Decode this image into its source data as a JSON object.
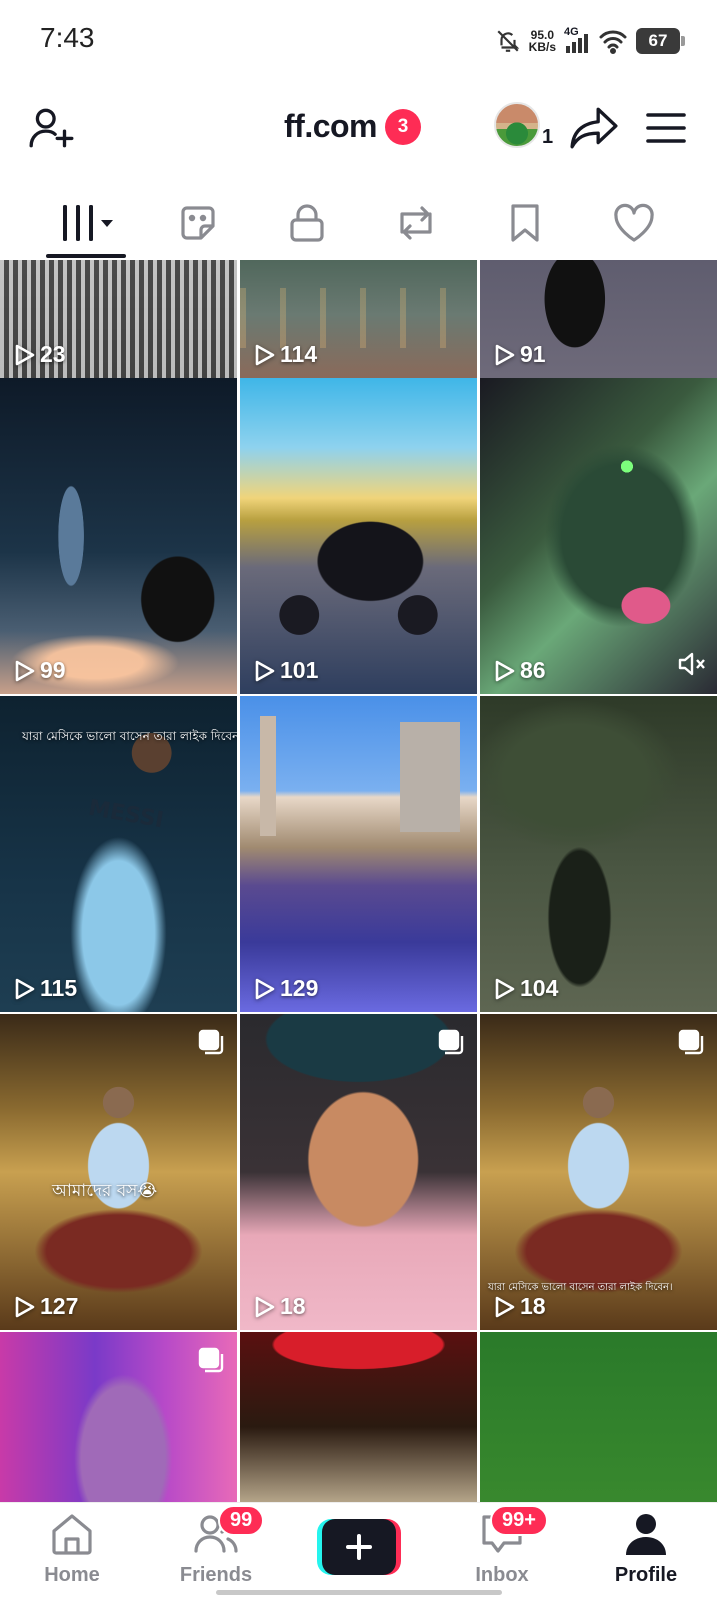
{
  "status_bar": {
    "time": "7:43",
    "net_speed_value": "95.0",
    "net_speed_unit": "KB/s",
    "network_type": "4G",
    "battery": "67"
  },
  "header": {
    "title": "ff.com",
    "title_badge": "3",
    "avatar_count": "1",
    "icons": [
      "add-user-icon",
      "share-icon",
      "menu-icon"
    ]
  },
  "tabs": [
    "videos-grid",
    "stickers",
    "private",
    "reposts",
    "favorites",
    "liked"
  ],
  "videos": [
    {
      "views": "23"
    },
    {
      "views": "114"
    },
    {
      "views": "91"
    },
    {
      "views": "99"
    },
    {
      "views": "101"
    },
    {
      "views": "86",
      "muted": true
    },
    {
      "views": "115",
      "caption": "যারা মেসিকে ভালো বাসেন তারা লাইক দিবেন।",
      "jersey": "MESSI"
    },
    {
      "views": "129"
    },
    {
      "views": "104"
    },
    {
      "views": "127",
      "caption": "আমাদের বস😭",
      "multi": true
    },
    {
      "views": "18",
      "multi": true
    },
    {
      "views": "18",
      "caption": "যারা মেসিকে ভালো বাসেন তারা লাইক দিবেন।",
      "multi": true
    },
    {
      "views": "",
      "multi": true
    },
    {
      "views": ""
    },
    {
      "views": ""
    }
  ],
  "bottom_nav": {
    "home": "Home",
    "friends": "Friends",
    "friends_badge": "99",
    "inbox": "Inbox",
    "inbox_badge": "99+",
    "profile": "Profile"
  },
  "colors": {
    "accent": "#fe2c55",
    "create_cyan": "#25f4ee",
    "text": "#161823",
    "muted": "#8a8b91"
  }
}
